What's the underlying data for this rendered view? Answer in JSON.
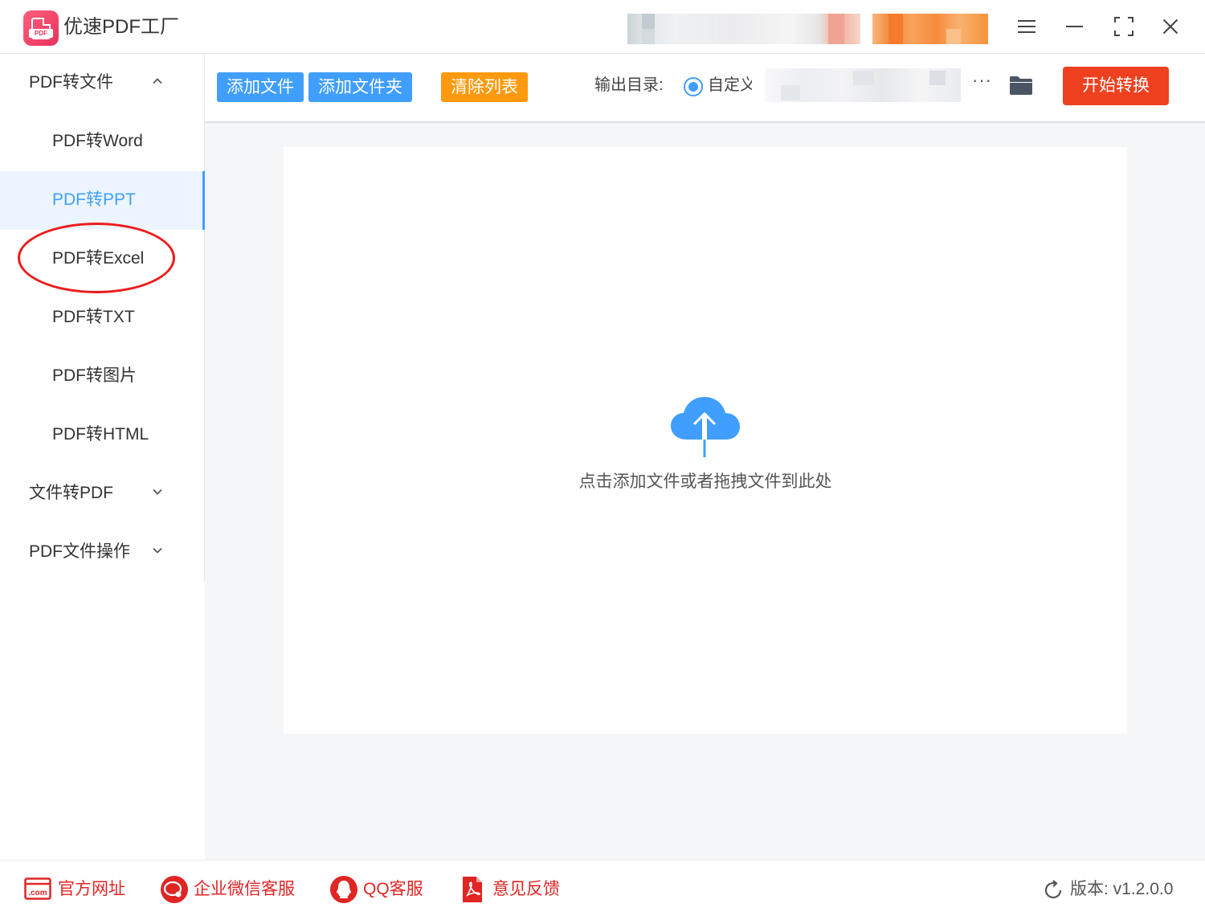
{
  "app": {
    "title": "优速PDF工厂",
    "logo_tag": "PDF"
  },
  "window_controls": {
    "menu": "menu-icon",
    "minimize": "minimize-icon",
    "maximize": "maximize-icon",
    "close": "close-icon"
  },
  "sidebar": {
    "groups": [
      {
        "label": "PDF转文件",
        "expanded": true,
        "chevron": "chevron-up-icon"
      },
      {
        "label": "文件转PDF",
        "expanded": false,
        "chevron": "chevron-down-icon"
      },
      {
        "label": "PDF文件操作",
        "expanded": false,
        "chevron": "chevron-down-icon"
      }
    ],
    "items": [
      {
        "label": "PDF转Word",
        "active": false
      },
      {
        "label": "PDF转PPT",
        "active": true
      },
      {
        "label": "PDF转Excel",
        "active": false
      },
      {
        "label": "PDF转TXT",
        "active": false
      },
      {
        "label": "PDF转图片",
        "active": false
      },
      {
        "label": "PDF转HTML",
        "active": false
      }
    ]
  },
  "toolbar": {
    "add_file": "添加文件",
    "add_folder": "添加文件夹",
    "clear_list": "清除列表",
    "output_label": "输出目录:",
    "output_option": "自定义",
    "more": "···",
    "start": "开始转换"
  },
  "dropzone": {
    "icon": "cloud-upload-icon",
    "text": "点击添加文件或者拖拽文件到此处"
  },
  "footer": {
    "website": "官方网址",
    "wechat": "企业微信客服",
    "qq": "QQ客服",
    "feedback": "意见反馈",
    "version": "版本: v1.2.0.0"
  },
  "colors": {
    "accent": "#409eff",
    "clear_button": "#ff9a0e",
    "start_button": "#ef4120",
    "footer_link": "#e02525",
    "annotation": "#ee1c1c"
  }
}
